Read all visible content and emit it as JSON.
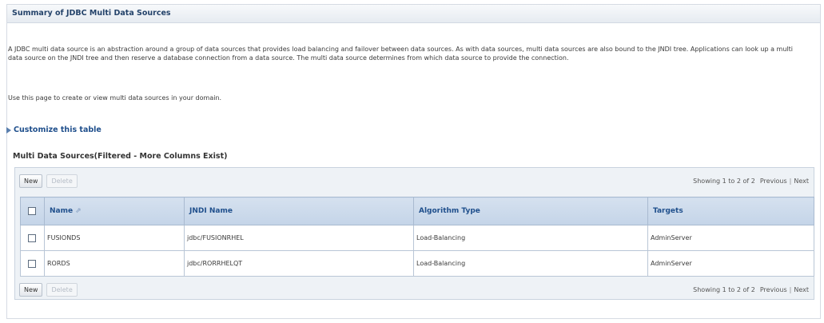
{
  "page": {
    "title": "Summary of JDBC Multi Data Sources",
    "description": "A JDBC multi data source is an abstraction around a group of data sources that provides load balancing and failover between data sources. As with data sources, multi data sources are also bound to the JNDI tree. Applications can look up a multi data source on the JNDI tree and then reserve a database connection from a data source. The multi data source determines from which data source to provide the connection.",
    "instructions": "Use this page to create or view multi data sources in your domain.",
    "customize_link": "Customize this table"
  },
  "table": {
    "caption": "Multi Data Sources(Filtered - More Columns Exist)",
    "toolbar": {
      "new_label": "New",
      "delete_label": "Delete",
      "showing": "Showing 1 to 2 of 2",
      "previous": "Previous",
      "separator": "|",
      "next": "Next"
    },
    "columns": [
      "Name",
      "JNDI Name",
      "Algorithm Type",
      "Targets"
    ],
    "sort_icon": "sort-ascending-icon",
    "rows": [
      {
        "name": "FUSIONDS",
        "jndi": "jdbc/FUSIONRHEL",
        "algorithm": "Load-Balancing",
        "targets": "AdminServer"
      },
      {
        "name": "RORDS",
        "jndi": "jdbc/RORRHELQT",
        "algorithm": "Load-Balancing",
        "targets": "AdminServer"
      }
    ]
  },
  "colors": {
    "title_text": "#24436a",
    "link": "#1f4f8c",
    "header_bg": "#c4d4e8",
    "panel_bg": "#eef2f6"
  }
}
